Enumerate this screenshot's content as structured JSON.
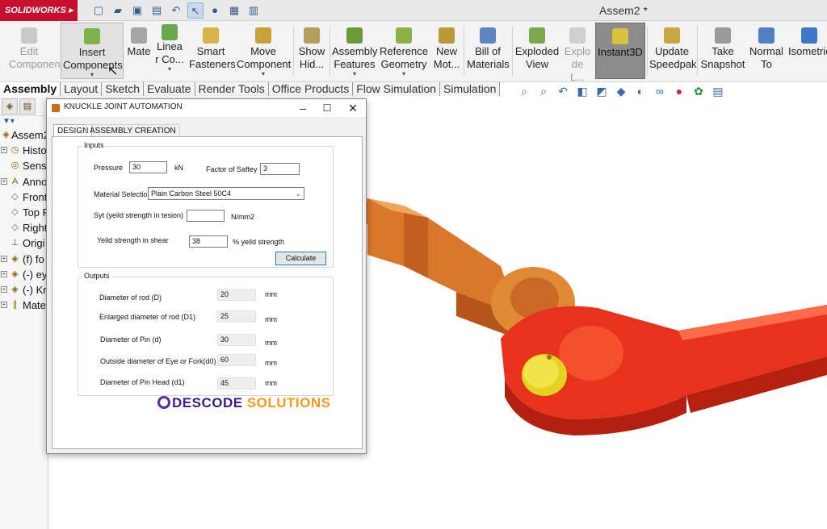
{
  "app": {
    "brand": "SOLIDWORKS",
    "document_title": "Assem2 *"
  },
  "ribbon": {
    "edit_component": "Edit Component",
    "insert_components": "Insert Components",
    "mate": "Mate",
    "linear_pattern": "Linea r Co...",
    "smart_fasteners": "Smart Fasteners",
    "move_component": "Move Component",
    "show_hidden": "Show Hid...",
    "assembly_features": "Assembly Features",
    "reference_geometry": "Reference Geometry",
    "new_motion": "New Mot...",
    "bill_of_materials": "Bill of Materials",
    "exploded_view": "Exploded View",
    "explode_line": "Explo de L...",
    "instant3d": "Instant3D",
    "update_speedpak": "Update Speedpak",
    "take_snapshot": "Take Snapshot",
    "normal_to": "Normal To",
    "isometric": "Isometric"
  },
  "tabs": [
    "Assembly",
    "Layout",
    "Sketch",
    "Evaluate",
    "Render Tools",
    "Office Products",
    "Flow Simulation",
    "Simulation"
  ],
  "tree": {
    "items": [
      {
        "label": "Assem2",
        "icon": "assembly-icon"
      },
      {
        "label": "Histo",
        "icon": "history-icon"
      },
      {
        "label": "Senso",
        "icon": "sensors-icon"
      },
      {
        "label": "Anno",
        "icon": "annotations-icon"
      },
      {
        "label": "Front",
        "icon": "plane-icon"
      },
      {
        "label": "Top P",
        "icon": "plane-icon"
      },
      {
        "label": "Right",
        "icon": "plane-icon"
      },
      {
        "label": "Origi",
        "icon": "origin-icon"
      },
      {
        "label": "(f) fo",
        "icon": "part-icon"
      },
      {
        "label": "(-) ey",
        "icon": "part-icon"
      },
      {
        "label": "(-) Kn",
        "icon": "part-icon"
      },
      {
        "label": "Mate",
        "icon": "mates-icon"
      }
    ]
  },
  "dialog": {
    "title": "KNUCKLE JOINT AUTOMATION",
    "tab_design": "DESIGN",
    "tab_assembly": "ASSEMBLY CREATION",
    "inputs_legend": "Inputs",
    "pressure_label": "Pressure",
    "pressure_value": "30",
    "pressure_unit": "kN",
    "fos_label": "Factor of Saftey",
    "fos_value": "3",
    "material_label": "Material Selection",
    "material_value": "Plain Carbon Steel 50C4",
    "syt_label": "Syt (yeild strength in tesion)",
    "syt_value": "",
    "syt_unit": "N/mm2",
    "shear_label": "Yeild strength in shear",
    "shear_value": "38",
    "shear_unit": "% yeild strength",
    "calculate": "Calculate",
    "outputs_legend": "Outputs",
    "outputs": [
      {
        "label": "Diameter of rod (D)",
        "value": "20",
        "unit": "mm"
      },
      {
        "label": "Enlarged diameter of rod (D1)",
        "value": "25",
        "unit": "mm"
      },
      {
        "label": "Diameter of Pin (d)",
        "value": "30",
        "unit": "mm"
      },
      {
        "label": "Outside diameter of Eye or Fork(d0)",
        "value": "60",
        "unit": "mm"
      },
      {
        "label": "Diameter of Pin Head (d1)",
        "value": "45",
        "unit": "mm"
      }
    ]
  },
  "watermark": {
    "part1": "DESCODE",
    "part2": "SOLUTIONS"
  },
  "colors": {
    "rod_orange": "#d9772a",
    "fork_red": "#e8321d",
    "pin_yellow": "#e3d21f",
    "brand_red": "#c8102e"
  }
}
